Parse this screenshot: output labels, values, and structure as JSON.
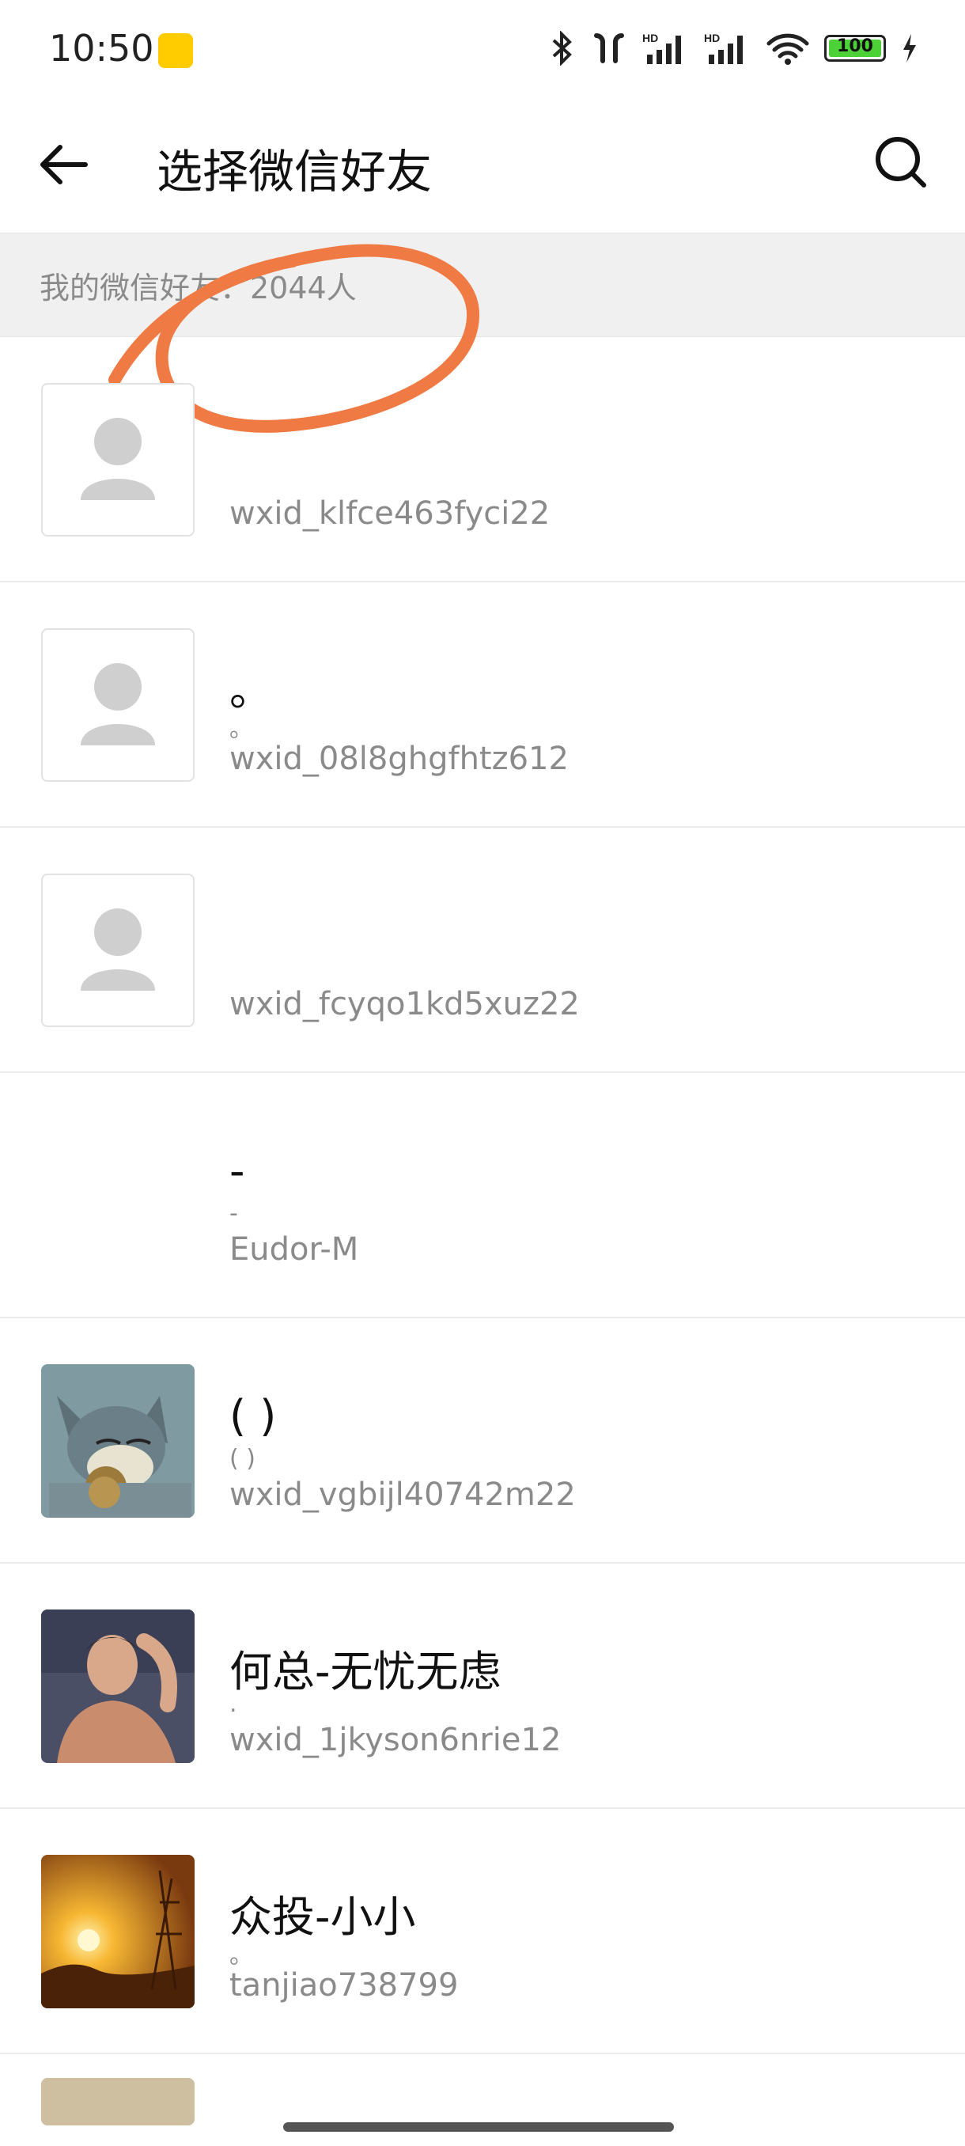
{
  "status_bar": {
    "time": "10:50",
    "battery": "100",
    "icons": [
      "app-badge-icon",
      "bluetooth-icon",
      "earbuds-icon",
      "signal-hd-icon",
      "signal-hd-icon",
      "wifi-icon",
      "battery-icon",
      "charging-icon"
    ]
  },
  "header": {
    "title": "选择微信好友",
    "back_icon": "back-arrow-icon",
    "search_icon": "search-icon"
  },
  "section": {
    "label": "我的微信好友：2044人"
  },
  "annotation_color": "#f07a43",
  "friends": [
    {
      "name": "",
      "remark": "",
      "wxid": "wxid_klfce463fyci22",
      "avatar": "placeholder"
    },
    {
      "name": "。",
      "remark": "。",
      "wxid": "wxid_08l8ghgfhtz612",
      "avatar": "placeholder"
    },
    {
      "name": "",
      "remark": "",
      "wxid": "wxid_fcyqo1kd5xuz22",
      "avatar": "placeholder"
    },
    {
      "name": "-",
      "remark": "-",
      "wxid": "Eudor-M",
      "avatar": "none"
    },
    {
      "name": "( )",
      "remark": "( )",
      "wxid": "wxid_vgbijl40742m22",
      "avatar": "cartoon-cat"
    },
    {
      "name": "何总-无忧无虑",
      "remark": ".",
      "wxid": "wxid_1jkyson6nrie12",
      "avatar": "man-photo"
    },
    {
      "name": "众投-小小",
      "remark": "。",
      "wxid": "tanjiao738799",
      "avatar": "sunset-photo"
    }
  ]
}
